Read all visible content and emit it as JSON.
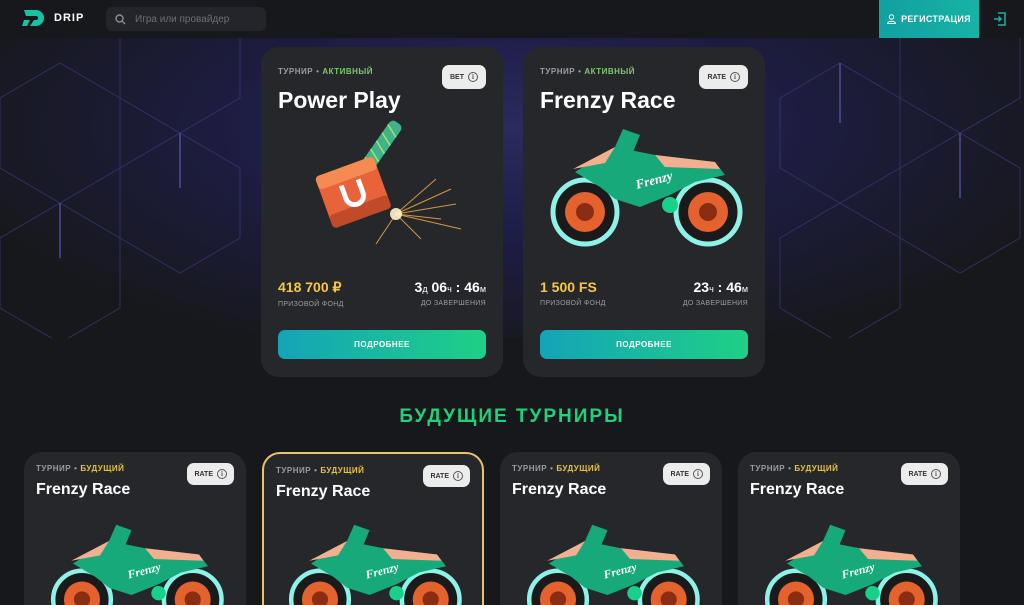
{
  "header": {
    "logo_text": "DRIP",
    "search_placeholder": "Игра или провайдер",
    "register_label": "РЕГИСТРАЦИЯ"
  },
  "active_tournaments": [
    {
      "status_type": "ТУРНИР",
      "status_state": "АКТИВНЫЙ",
      "badge": "BET",
      "title": "Power Play",
      "prize_value": "418 700 ₽",
      "prize_label": "ПРИЗОВОЙ ФОНД",
      "timer_d": "3",
      "timer_d_unit": "д",
      "timer_h": "06",
      "timer_h_unit": "ч",
      "timer_m": "46",
      "timer_m_unit": "м",
      "timer_label": "ДО ЗАВЕРШЕНИЯ",
      "button_label": "ПОДРОБНЕЕ"
    },
    {
      "status_type": "ТУРНИР",
      "status_state": "АКТИВНЫЙ",
      "badge": "RATE",
      "title": "Frenzy Race",
      "prize_value": "1 500 FS",
      "prize_label": "ПРИЗОВОЙ ФОНД",
      "timer_h": "23",
      "timer_h_unit": "ч",
      "timer_m": "46",
      "timer_m_unit": "м",
      "timer_label": "ДО ЗАВЕРШЕНИЯ",
      "button_label": "ПОДРОБНЕЕ"
    }
  ],
  "future_section_title": "БУДУЩИЕ ТУРНИРЫ",
  "future_tournaments": [
    {
      "status_type": "ТУРНИР",
      "status_state": "БУДУЩИЙ",
      "badge": "RATE",
      "title": "Frenzy Race"
    },
    {
      "status_type": "ТУРНИР",
      "status_state": "БУДУЩИЙ",
      "badge": "RATE",
      "title": "Frenzy Race"
    },
    {
      "status_type": "ТУРНИР",
      "status_state": "БУДУЩИЙ",
      "badge": "RATE",
      "title": "Frenzy Race"
    },
    {
      "status_type": "ТУРНИР",
      "status_state": "БУДУЩИЙ",
      "badge": "RATE",
      "title": "Frenzy Race"
    }
  ],
  "bike_logo_text": "Frenzy",
  "colors": {
    "accent_teal": "#16b3a5",
    "active_green": "#7ec86b",
    "future_yellow": "#e6c243",
    "prize_gold": "#f5c744",
    "section_green": "#20d07a",
    "highlight_border": "#e8c46a"
  }
}
